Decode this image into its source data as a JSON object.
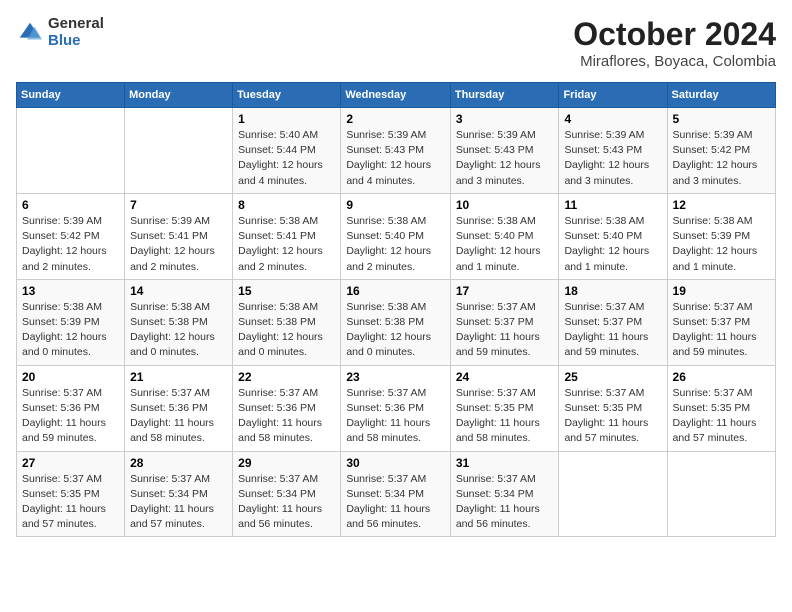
{
  "header": {
    "logo_general": "General",
    "logo_blue": "Blue",
    "month_year": "October 2024",
    "location": "Miraflores, Boyaca, Colombia"
  },
  "days_of_week": [
    "Sunday",
    "Monday",
    "Tuesday",
    "Wednesday",
    "Thursday",
    "Friday",
    "Saturday"
  ],
  "weeks": [
    [
      {
        "day": "",
        "info": ""
      },
      {
        "day": "",
        "info": ""
      },
      {
        "day": "1",
        "info": "Sunrise: 5:40 AM\nSunset: 5:44 PM\nDaylight: 12 hours and 4 minutes."
      },
      {
        "day": "2",
        "info": "Sunrise: 5:39 AM\nSunset: 5:43 PM\nDaylight: 12 hours and 4 minutes."
      },
      {
        "day": "3",
        "info": "Sunrise: 5:39 AM\nSunset: 5:43 PM\nDaylight: 12 hours and 3 minutes."
      },
      {
        "day": "4",
        "info": "Sunrise: 5:39 AM\nSunset: 5:43 PM\nDaylight: 12 hours and 3 minutes."
      },
      {
        "day": "5",
        "info": "Sunrise: 5:39 AM\nSunset: 5:42 PM\nDaylight: 12 hours and 3 minutes."
      }
    ],
    [
      {
        "day": "6",
        "info": "Sunrise: 5:39 AM\nSunset: 5:42 PM\nDaylight: 12 hours and 2 minutes."
      },
      {
        "day": "7",
        "info": "Sunrise: 5:39 AM\nSunset: 5:41 PM\nDaylight: 12 hours and 2 minutes."
      },
      {
        "day": "8",
        "info": "Sunrise: 5:38 AM\nSunset: 5:41 PM\nDaylight: 12 hours and 2 minutes."
      },
      {
        "day": "9",
        "info": "Sunrise: 5:38 AM\nSunset: 5:40 PM\nDaylight: 12 hours and 2 minutes."
      },
      {
        "day": "10",
        "info": "Sunrise: 5:38 AM\nSunset: 5:40 PM\nDaylight: 12 hours and 1 minute."
      },
      {
        "day": "11",
        "info": "Sunrise: 5:38 AM\nSunset: 5:40 PM\nDaylight: 12 hours and 1 minute."
      },
      {
        "day": "12",
        "info": "Sunrise: 5:38 AM\nSunset: 5:39 PM\nDaylight: 12 hours and 1 minute."
      }
    ],
    [
      {
        "day": "13",
        "info": "Sunrise: 5:38 AM\nSunset: 5:39 PM\nDaylight: 12 hours and 0 minutes."
      },
      {
        "day": "14",
        "info": "Sunrise: 5:38 AM\nSunset: 5:38 PM\nDaylight: 12 hours and 0 minutes."
      },
      {
        "day": "15",
        "info": "Sunrise: 5:38 AM\nSunset: 5:38 PM\nDaylight: 12 hours and 0 minutes."
      },
      {
        "day": "16",
        "info": "Sunrise: 5:38 AM\nSunset: 5:38 PM\nDaylight: 12 hours and 0 minutes."
      },
      {
        "day": "17",
        "info": "Sunrise: 5:37 AM\nSunset: 5:37 PM\nDaylight: 11 hours and 59 minutes."
      },
      {
        "day": "18",
        "info": "Sunrise: 5:37 AM\nSunset: 5:37 PM\nDaylight: 11 hours and 59 minutes."
      },
      {
        "day": "19",
        "info": "Sunrise: 5:37 AM\nSunset: 5:37 PM\nDaylight: 11 hours and 59 minutes."
      }
    ],
    [
      {
        "day": "20",
        "info": "Sunrise: 5:37 AM\nSunset: 5:36 PM\nDaylight: 11 hours and 59 minutes."
      },
      {
        "day": "21",
        "info": "Sunrise: 5:37 AM\nSunset: 5:36 PM\nDaylight: 11 hours and 58 minutes."
      },
      {
        "day": "22",
        "info": "Sunrise: 5:37 AM\nSunset: 5:36 PM\nDaylight: 11 hours and 58 minutes."
      },
      {
        "day": "23",
        "info": "Sunrise: 5:37 AM\nSunset: 5:36 PM\nDaylight: 11 hours and 58 minutes."
      },
      {
        "day": "24",
        "info": "Sunrise: 5:37 AM\nSunset: 5:35 PM\nDaylight: 11 hours and 58 minutes."
      },
      {
        "day": "25",
        "info": "Sunrise: 5:37 AM\nSunset: 5:35 PM\nDaylight: 11 hours and 57 minutes."
      },
      {
        "day": "26",
        "info": "Sunrise: 5:37 AM\nSunset: 5:35 PM\nDaylight: 11 hours and 57 minutes."
      }
    ],
    [
      {
        "day": "27",
        "info": "Sunrise: 5:37 AM\nSunset: 5:35 PM\nDaylight: 11 hours and 57 minutes."
      },
      {
        "day": "28",
        "info": "Sunrise: 5:37 AM\nSunset: 5:34 PM\nDaylight: 11 hours and 57 minutes."
      },
      {
        "day": "29",
        "info": "Sunrise: 5:37 AM\nSunset: 5:34 PM\nDaylight: 11 hours and 56 minutes."
      },
      {
        "day": "30",
        "info": "Sunrise: 5:37 AM\nSunset: 5:34 PM\nDaylight: 11 hours and 56 minutes."
      },
      {
        "day": "31",
        "info": "Sunrise: 5:37 AM\nSunset: 5:34 PM\nDaylight: 11 hours and 56 minutes."
      },
      {
        "day": "",
        "info": ""
      },
      {
        "day": "",
        "info": ""
      }
    ]
  ]
}
